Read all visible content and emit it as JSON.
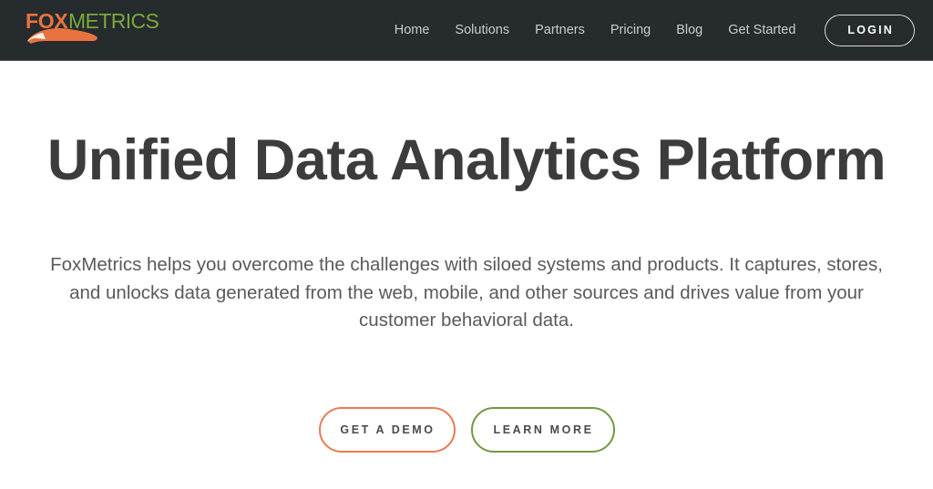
{
  "header": {
    "background_color": "#262b2d",
    "logo": {
      "name": "foxmetrics-logo",
      "text_primary": "FOX",
      "text_secondary": "METRICS",
      "primary_color": "#e8733f",
      "secondary_color": "#7ca83f"
    },
    "nav_items": [
      {
        "label": "Home"
      },
      {
        "label": "Solutions"
      },
      {
        "label": "Partners"
      },
      {
        "label": "Pricing"
      },
      {
        "label": "Blog"
      },
      {
        "label": "Get Started"
      }
    ],
    "login_label": "LOGIN"
  },
  "hero": {
    "title": "Unified Data Analytics Platform",
    "description": "FoxMetrics helps you overcome the challenges with siloed systems and products. It captures, stores, and unlocks data generated from the web, mobile, and other sources and drives value from your customer behavioral data.",
    "buttons": {
      "demo_label": "GET A DEMO",
      "demo_border_color": "#ec7a52",
      "learn_label": "LEARN MORE",
      "learn_border_color": "#6d9b3f"
    },
    "title_color": "#3c3c3c",
    "description_color": "#5a5a5c"
  }
}
